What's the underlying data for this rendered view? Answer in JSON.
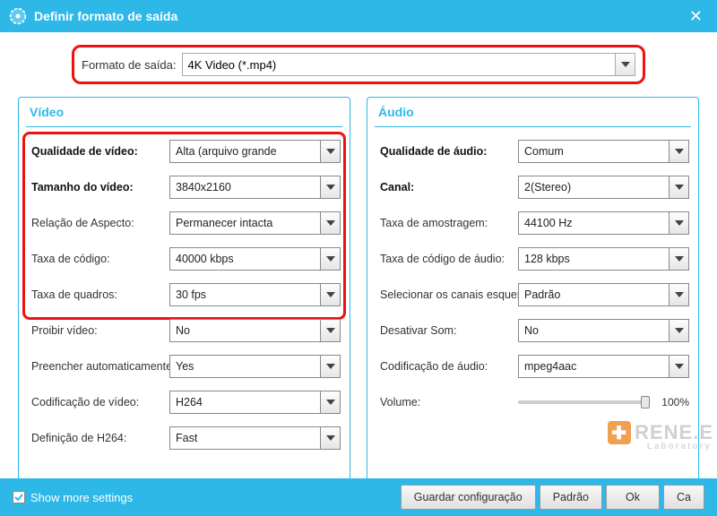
{
  "window": {
    "title": "Definir formato de saída"
  },
  "output": {
    "label": "Formato de saída:",
    "value": "4K Video (*.mp4)"
  },
  "video": {
    "title": "Vídeo",
    "fields": [
      {
        "label": "Qualidade de vídeo:",
        "value": "Alta (arquivo grande",
        "bold": true
      },
      {
        "label": "Tamanho do vídeo:",
        "value": "3840x2160",
        "bold": true
      },
      {
        "label": "Relação de Aspecto:",
        "value": "Permanecer intacta",
        "bold": false
      },
      {
        "label": "Taxa de código:",
        "value": "40000 kbps",
        "bold": false
      },
      {
        "label": "Taxa de quadros:",
        "value": "30 fps",
        "bold": false
      },
      {
        "label": "Proibir vídeo:",
        "value": "No",
        "bold": false
      },
      {
        "label": "Preencher automaticamente c",
        "value": "Yes",
        "bold": false
      },
      {
        "label": "Codificação de vídeo:",
        "value": "H264",
        "bold": false
      },
      {
        "label": "Definição de H264:",
        "value": "Fast",
        "bold": false
      }
    ]
  },
  "audio": {
    "title": "Áudio",
    "fields": [
      {
        "label": "Qualidade de áudio:",
        "value": "Comum",
        "bold": true
      },
      {
        "label": "Canal:",
        "value": "2(Stereo)",
        "bold": true
      },
      {
        "label": "Taxa de amostragem:",
        "value": "44100 Hz",
        "bold": false
      },
      {
        "label": "Taxa de código de áudio:",
        "value": "128 kbps",
        "bold": false
      },
      {
        "label": "Selecionar os canais esquerdo",
        "value": "Padrão",
        "bold": false
      },
      {
        "label": "Desativar Som:",
        "value": "No",
        "bold": false
      },
      {
        "label": "Codificação de áudio:",
        "value": "mpeg4aac",
        "bold": false
      }
    ],
    "volume": {
      "label": "Volume:",
      "value": "100%"
    }
  },
  "footer": {
    "show_more": "Show more settings",
    "save": "Guardar configuração",
    "default": "Padrão",
    "ok": "Ok",
    "cancel": "Ca"
  },
  "watermark": {
    "brand": "RENE.E",
    "sub": "Laboratory"
  }
}
